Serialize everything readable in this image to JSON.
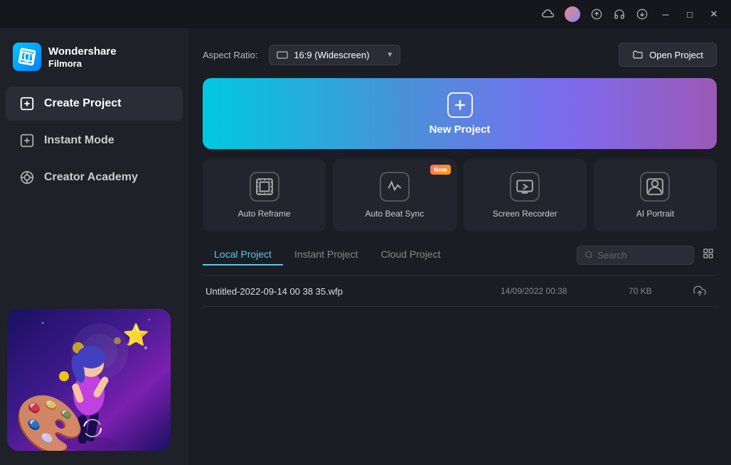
{
  "app": {
    "name": "Wondershare",
    "subname": "Filmora",
    "logo_initial": "F"
  },
  "titlebar": {
    "icons": [
      "cloud",
      "avatar",
      "upload",
      "headset",
      "download"
    ],
    "controls": [
      "minimize",
      "maximize",
      "close"
    ]
  },
  "sidebar": {
    "nav_items": [
      {
        "id": "create-project",
        "label": "Create Project",
        "active": true
      },
      {
        "id": "instant-mode",
        "label": "Instant Mode",
        "active": false
      },
      {
        "id": "creator-academy",
        "label": "Creator Academy",
        "active": false
      }
    ]
  },
  "topbar": {
    "aspect_ratio_label": "Aspect Ratio:",
    "aspect_ratio_value": "16:9 (Widescreen)",
    "open_project_label": "Open Project"
  },
  "new_project": {
    "label": "New Project"
  },
  "feature_cards": [
    {
      "id": "auto-reframe",
      "label": "Auto Reframe",
      "icon": "⬜",
      "new": false
    },
    {
      "id": "auto-beat-sync",
      "label": "Auto Beat Sync",
      "icon": "🎵",
      "new": true
    },
    {
      "id": "screen-recorder",
      "label": "Screen Recorder",
      "icon": "📺",
      "new": false
    },
    {
      "id": "ai-portrait",
      "label": "AI Portrait",
      "icon": "👤",
      "new": false
    }
  ],
  "projects": {
    "tabs": [
      {
        "id": "local",
        "label": "Local Project",
        "active": true
      },
      {
        "id": "instant",
        "label": "Instant Project",
        "active": false
      },
      {
        "id": "cloud",
        "label": "Cloud Project",
        "active": false
      }
    ],
    "search_placeholder": "Search",
    "items": [
      {
        "name": "Untitled-2022-09-14 00 38 35.wfp",
        "date": "14/09/2022 00:38",
        "size": "70 KB"
      }
    ]
  }
}
